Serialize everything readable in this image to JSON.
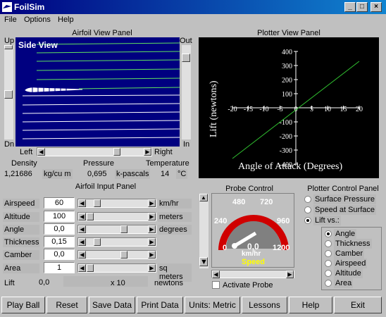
{
  "window": {
    "title": "FoilSim",
    "min": "_",
    "max": "□",
    "close": "×"
  },
  "menu": [
    "File",
    "Options",
    "Help"
  ],
  "airfoil_view": {
    "title": "Airfoil View Panel",
    "up": "Up",
    "dn": "Dn",
    "out": "Out",
    "in": "In",
    "side_view": "Side View",
    "left": "Left",
    "right": "Right"
  },
  "conditions": {
    "density_label": "Density",
    "pressure_label": "Pressure",
    "temperature_label": "Temperature",
    "density_value": "1,21686",
    "density_unit": "kg/cu m",
    "pressure_value": "0,695",
    "pressure_unit": "k-pascals",
    "temperature_value": "14",
    "temperature_unit": "°C"
  },
  "plotter_view": {
    "title": "Plotter View Panel",
    "ylabel": "Lift (newtons)",
    "xlabel": "Angle of Attack (Degrees)"
  },
  "chart_data": {
    "type": "line",
    "xlabel": "Angle of Attack (Degrees)",
    "ylabel": "Lift (newtons)",
    "xlim": [
      -20,
      20
    ],
    "ylim": [
      -400,
      400
    ],
    "xticks": [
      "-20",
      "-15",
      "-10",
      "-5",
      "0",
      "5",
      "10",
      "15",
      "20"
    ],
    "yticks": [
      "400",
      "300",
      "200",
      "100",
      "",
      "-100",
      "-200",
      "-300",
      "-400"
    ],
    "x": [
      -20,
      20
    ],
    "y": [
      -360,
      330
    ],
    "line_color": "#30c030",
    "background": "#000000"
  },
  "input_panel": {
    "title": "Airfoil Input Panel",
    "rows": [
      {
        "label": "Airspeed",
        "value": "60",
        "unit": "km/hr"
      },
      {
        "label": "Altitude",
        "value": "100",
        "unit": "meters"
      },
      {
        "label": "Angle",
        "value": "0,0",
        "unit": "degrees"
      },
      {
        "label": "Thickness",
        "value": "0,15",
        "unit": ""
      },
      {
        "label": "Camber",
        "value": "0,0",
        "unit": ""
      },
      {
        "label": "Area",
        "value": "1",
        "unit": "sq meters"
      }
    ],
    "lift_label": "Lift",
    "lift_value": "0,0",
    "lift_scale": "x 10",
    "lift_unit": "newtons"
  },
  "probe": {
    "title": "Probe Control",
    "gauge_ticks": [
      "0",
      "240",
      "480",
      "720",
      "960",
      "1200"
    ],
    "reading_value": "0,0",
    "reading_unit": "km/hr",
    "reading_label": "Speed",
    "activate_label": "Activate Probe"
  },
  "plot_control": {
    "title": "Plotter Control Panel",
    "options": [
      "Surface Pressure",
      "Speed at Surface",
      "Lift vs.:"
    ],
    "selected": "Lift vs.:",
    "sub_options": [
      "Angle",
      "Thickness",
      "Camber",
      "Airspeed",
      "Altitude",
      "Area"
    ],
    "sub_selected": "Angle"
  },
  "buttons": [
    "Play Ball",
    "Reset",
    "Save Data",
    "Print Data",
    "Units: Metric",
    "Lessons",
    "Help",
    "Exit"
  ]
}
